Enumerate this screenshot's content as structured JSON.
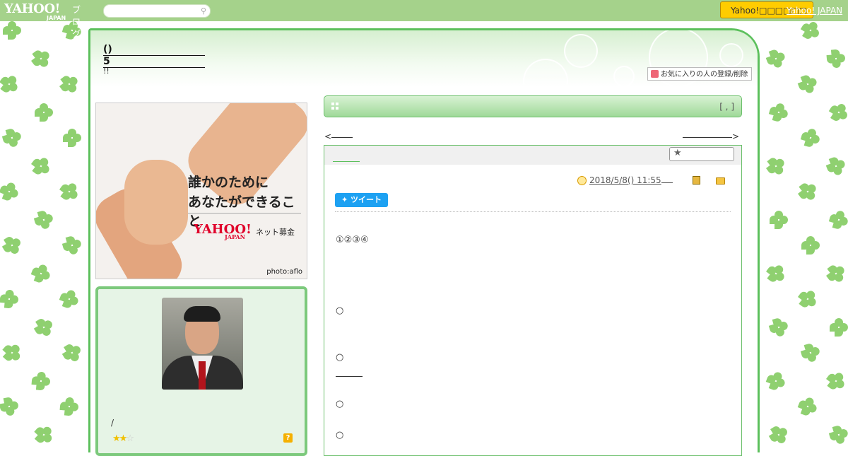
{
  "topbar": {
    "logo_main": "YAHOO!",
    "logo_sub": "JAPAN",
    "logo_blog": "ブログ",
    "search_placeholder": "",
    "search_icon": "search-icon",
    "yj_button": "Yahoo!□□□□□□",
    "yj_link": "Yahoo! JAPAN"
  },
  "header": {
    "title_line1": "()",
    "title_line2": "5",
    "description": "!!",
    "favorite_button": "お気に入りの人の登録/削除"
  },
  "ad": {
    "line1": "誰かのために",
    "line2": "あなたができること",
    "brand": "YAHOO!",
    "brand_sub": "JAPAN",
    "service": "ネット募金",
    "credit": "photo:aflo"
  },
  "profile": {
    "name": "/",
    "rating": 2,
    "rating_max": 3,
    "help_icon": "?"
  },
  "category": {
    "bracket": "[ , ]",
    "icon": "grid-icon"
  },
  "pager": {
    "prev": "<",
    "next": ">"
  },
  "article": {
    "star_icon": "★",
    "date": "2018/5/8()  11:55",
    "tweet": "ツイート",
    "numbers": "①②③④",
    "bullets": [
      "○",
      "○",
      "○",
      "○"
    ]
  },
  "colors": {
    "topbar": "#a5d28b",
    "frame_green": "#5cc05c",
    "profile_bg": "#e6f4e6",
    "yj_button": "#ffcc00",
    "tweet": "#1da1f2"
  }
}
